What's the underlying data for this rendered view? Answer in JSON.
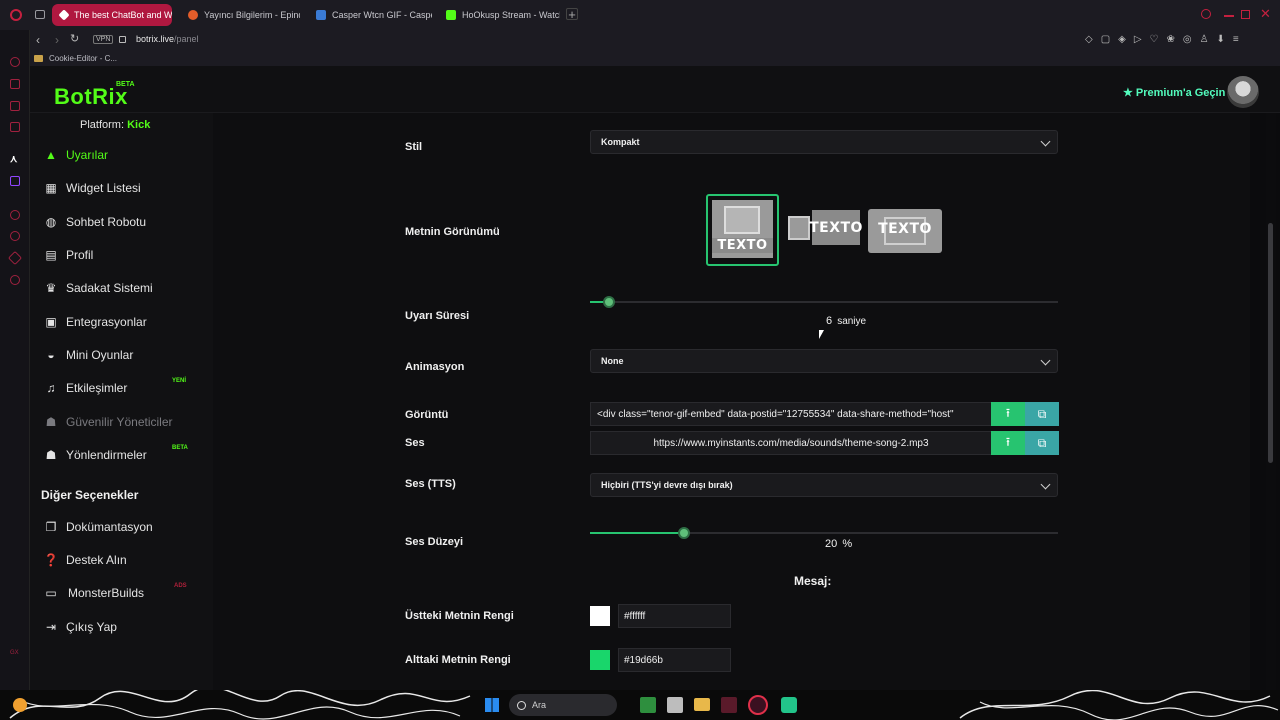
{
  "browser": {
    "tabs": [
      {
        "title": "The best ChatBot and Wi",
        "active": true
      },
      {
        "title": "Yayıncı Bilgilerim - Epindi"
      },
      {
        "title": "Casper Wtcn GIF - Caspe"
      },
      {
        "title": "HoOkusp Stream - Watch"
      }
    ],
    "address": {
      "vpn": "VPN",
      "domain": "botrix.live",
      "path": "/panel"
    },
    "bookmark": "Cookie-Editor - C..."
  },
  "app": {
    "logo": "BotRix",
    "logo_badge": "BETA",
    "premium_label": "Premium'a Geçin",
    "platform_label": "Platform:",
    "platform_value": "Kick"
  },
  "sidebar": {
    "items": [
      {
        "label": "Uyarılar",
        "icon": "warning-icon"
      },
      {
        "label": "Widget Listesi",
        "icon": "grid-icon"
      },
      {
        "label": "Sohbet Robotu",
        "icon": "robot-icon"
      },
      {
        "label": "Profil",
        "icon": "id-card-icon"
      },
      {
        "label": "Sadakat Sistemi",
        "icon": "trophy-icon"
      },
      {
        "label": "Entegrasyonlar",
        "icon": "list-icon"
      },
      {
        "label": "Mini Oyunlar",
        "icon": "gamepad-icon"
      },
      {
        "label": "Etkileşimler",
        "icon": "music-icon",
        "badge": "YENİ"
      },
      {
        "label": "Güvenilir Yöneticiler",
        "icon": "users-icon"
      },
      {
        "label": "Yönlendirmeler",
        "icon": "users-icon",
        "badge": "BETA"
      }
    ],
    "section_title": "Diğer Seçenekler",
    "other": [
      {
        "label": "Dokümantasyon",
        "icon": "copy-icon"
      },
      {
        "label": "Destek Alın",
        "icon": "question-icon"
      },
      {
        "label": "MonsterBuilds",
        "icon": "laptop-icon",
        "badge": "ADS"
      },
      {
        "label": "Çıkış Yap",
        "icon": "logout-icon"
      }
    ]
  },
  "form": {
    "style_label": "Stil",
    "style_value": "Kompakt",
    "layout_label": "Metnin Görünümü",
    "layout_text": "TEXTO",
    "duration_label": "Uyarı Süresi",
    "duration_value": "6",
    "duration_unit": "saniye",
    "duration_fraction": 0.04,
    "animation_label": "Animasyon",
    "animation_value": "None",
    "image_label": "Görüntü",
    "image_value": "<div class=\"tenor-gif-embed\" data-postid=\"12755534\" data-share-method=\"host\"",
    "sound_label": "Ses",
    "sound_value": "https://www.myinstants.com/media/sounds/theme-song-2.mp3",
    "tts_label": "Ses (TTS)",
    "tts_value": "Hiçbiri (TTS'yi devre dışı bırak)",
    "volume_label": "Ses Düzeyi",
    "volume_value": "20",
    "volume_unit": "%",
    "volume_fraction": 0.2,
    "message_heading": "Mesaj:",
    "top_color_label": "Üstteki Metnin Rengi",
    "top_color_value": "#ffffff",
    "bottom_color_label": "Alttaki Metnin Rengi",
    "bottom_color_value": "#19d66b"
  },
  "taskbar": {
    "search_placeholder": "Ara"
  },
  "colors": {
    "brand": "#53fc18",
    "accent_green": "#27c470",
    "browser_accent": "#b01840"
  }
}
